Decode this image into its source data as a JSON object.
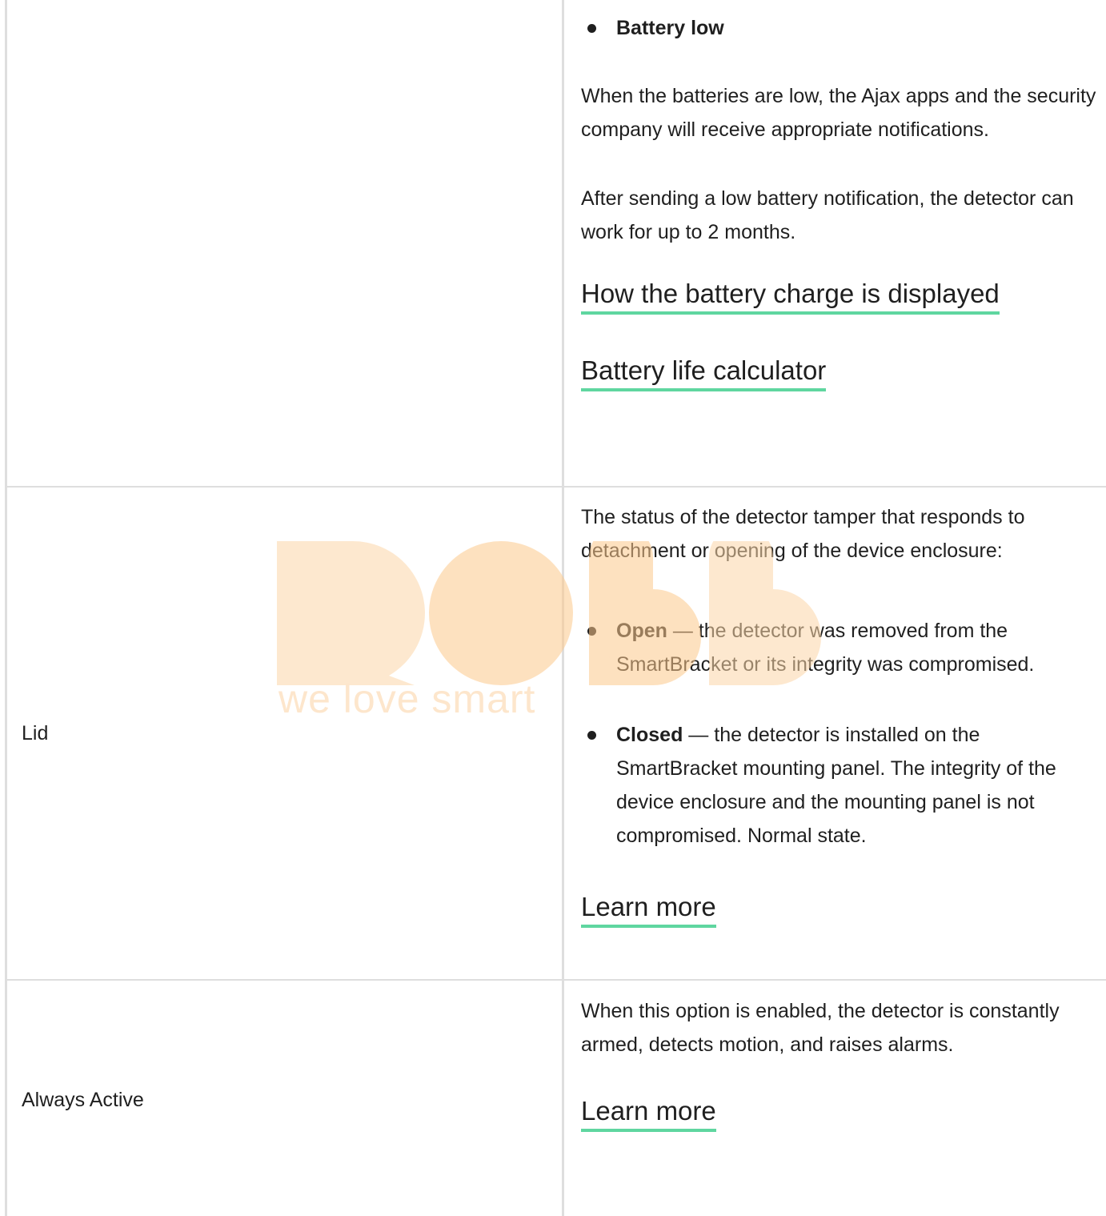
{
  "rows": [
    {
      "right": {
        "bullet_top": "Battery low",
        "p1": "When the batteries are low, the Ajax apps and the security company will receive appropriate notifications.",
        "p2": "After sending a low battery notification, the detector can work for up to 2 months.",
        "link1": "How the battery charge is displayed",
        "link2": "Battery life calculator"
      }
    },
    {
      "left": "Lid",
      "right": {
        "intro": "The status of the detector tamper that responds to detachment or opening of the device enclosure:",
        "bullets": [
          {
            "term": "Open",
            "text": " — the detector was removed from the SmartBracket or its integrity was compromised."
          },
          {
            "term": "Closed",
            "text": " — the detector is installed on the SmartBracket mounting panel. The integrity of the device enclosure and the mounting panel is not compromised. Normal state."
          }
        ],
        "link": "Learn more"
      }
    },
    {
      "left": "Always Active",
      "right": {
        "p1": "When this option is enabled, the detector is constantly armed, detects motion, and raises alarms.",
        "link": "Learn more"
      }
    }
  ],
  "watermark": {
    "tagline": "we love smart",
    "color": "#fde3c4"
  },
  "colors": {
    "link_underline": "#5fd6a0",
    "border": "#dedede",
    "text": "#1f1f1f"
  }
}
